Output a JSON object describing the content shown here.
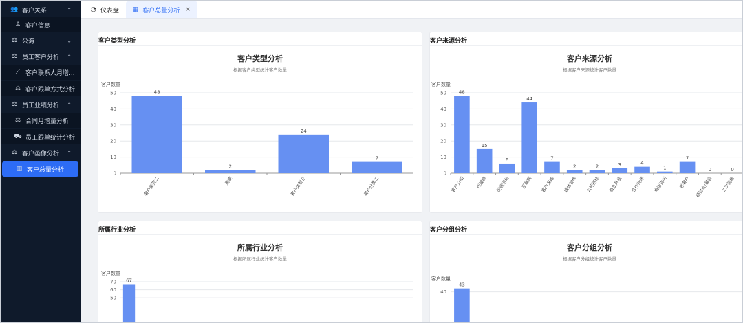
{
  "sidebar": {
    "items": [
      {
        "id": "customer-relation",
        "label": "客户关系",
        "icon": "users-icon",
        "level": 0,
        "chevron": "^"
      },
      {
        "id": "customer-info",
        "label": "客户信息",
        "icon": "user-icon",
        "level": 1
      },
      {
        "id": "public-sea",
        "label": "公海",
        "icon": "scale-icon",
        "level": 0,
        "chevron": "v"
      },
      {
        "id": "staff-customer-analysis",
        "label": "员工客户分析",
        "icon": "scale-icon",
        "level": 0,
        "chevron": "^"
      },
      {
        "id": "customer-contact-monthly",
        "label": "客户联系人月增...",
        "icon": "line-chart-icon",
        "level": 1
      },
      {
        "id": "follow-method-analysis",
        "label": "客户跟单方式分析",
        "icon": "scale-icon",
        "level": 1
      },
      {
        "id": "staff-performance",
        "label": "员工业绩分析",
        "icon": "scale-icon",
        "level": 0,
        "chevron": "^"
      },
      {
        "id": "contract-monthly",
        "label": "合同月增量分析",
        "icon": "scale-icon",
        "level": 1
      },
      {
        "id": "staff-follow-stats",
        "label": "员工跟单统计分析",
        "icon": "cart-icon",
        "level": 1
      },
      {
        "id": "customer-portrait",
        "label": "客户画像分析",
        "icon": "scale-icon",
        "level": 0,
        "chevron": "^"
      },
      {
        "id": "customer-total",
        "label": "客户总量分析",
        "icon": "bar-chart-icon",
        "level": 1,
        "active": true
      }
    ]
  },
  "tabs": [
    {
      "label": "仪表盘",
      "icon": "dashboard-icon",
      "active": false
    },
    {
      "label": "客户总量分析",
      "icon": "grid-icon",
      "active": true,
      "close": "×"
    }
  ],
  "colors": {
    "bar": "#6690f2",
    "accent": "#2d6cf5",
    "sidebar": "#0f1a2b"
  },
  "panels": {
    "type": {
      "header": "客户类型分析",
      "title": "客户类型分析",
      "subtitle": "根据客户类型统计客户数量"
    },
    "source": {
      "header": "客户来源分析",
      "title": "客户来源分析",
      "subtitle": "根据客户来源统计客户数量"
    },
    "industry": {
      "header": "所属行业分析",
      "title": "所属行业分析",
      "subtitle": "根据所属行业统计客户数量"
    },
    "group": {
      "header": "客户分组分析",
      "title": "客户分组分析",
      "subtitle": "根据客户分组统计客户数量"
    }
  },
  "chart_data": [
    {
      "id": "type",
      "type": "bar",
      "ylabel": "客户数量",
      "ylim": [
        0,
        50
      ],
      "yticks": [
        0,
        10,
        20,
        30,
        40,
        50
      ],
      "categories": [
        "客户类型二",
        "重要",
        "客户类型三",
        "客户分类二"
      ],
      "values": [
        48,
        2,
        24,
        7
      ]
    },
    {
      "id": "source",
      "type": "bar",
      "ylabel": "客户数量",
      "ylim": [
        0,
        50
      ],
      "yticks": [
        0,
        10,
        20,
        30,
        40,
        50
      ],
      "categories": [
        "客户介绍",
        "代理商",
        "促销活动",
        "互联网",
        "客户来电",
        "媒体宣传",
        "公开招标",
        "独立开发",
        "合作伙伴",
        "电话访问",
        "老客户",
        "研讨会/展会",
        "二次销售"
      ],
      "values": [
        48,
        15,
        6,
        44,
        7,
        2,
        2,
        3,
        4,
        1,
        7,
        0,
        0
      ]
    },
    {
      "id": "industry",
      "type": "bar",
      "ylabel": "客户数量",
      "ylim": [
        0,
        70
      ],
      "yticks": [
        50,
        60,
        70
      ],
      "categories": [
        ""
      ],
      "values": [
        67
      ]
    },
    {
      "id": "group",
      "type": "bar",
      "ylabel": "客户数量",
      "ylim": [
        0,
        43
      ],
      "yticks": [
        40
      ],
      "categories": [
        ""
      ],
      "values": [
        43
      ]
    }
  ]
}
